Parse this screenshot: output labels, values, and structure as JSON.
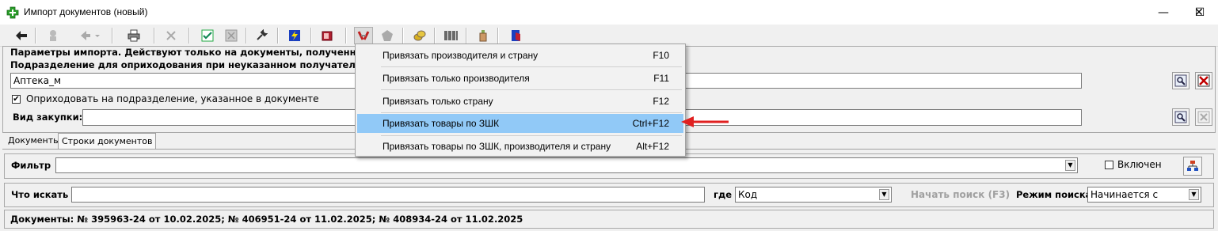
{
  "window": {
    "title": "Импорт документов (новый)",
    "minimize": "—",
    "maximize": "☐",
    "close": "✕"
  },
  "params": {
    "header": "Параметры импорта. Действуют только на документы, полученные НЕ п",
    "dept_label": "Подразделение для оприходования при неуказанном получателе",
    "dept_value": "Аптека_м",
    "checkbox_label": "Оприходовать на подразделение, указанное в документе",
    "checkbox_checked": true,
    "purchase_label": "Вид закупки:",
    "purchase_value": ""
  },
  "tabs": [
    "Документы",
    "Строки документов"
  ],
  "filter": {
    "label": "Фильтр",
    "value": "",
    "enabled_label": "Включен",
    "enabled": false
  },
  "search": {
    "label": "Что искать",
    "value": "",
    "where_label": "где",
    "where_value": "Код",
    "start_button": "Начать поиск (F3)",
    "mode_label": "Режим поиска",
    "mode_value": "Начинается с"
  },
  "status": "Документы: № 395963-24 от 10.02.2025; № 406951-24 от 11.02.2025; № 408934-24 от 11.02.2025",
  "menu": {
    "items": [
      {
        "label": "Привязать производителя и страну",
        "shortcut": "F10"
      },
      {
        "label": "Привязать только производителя",
        "shortcut": "F11"
      },
      {
        "label": "Привязать только страну",
        "shortcut": "F12"
      },
      {
        "label": "Привязать товары по ЗШК",
        "shortcut": "Ctrl+F12"
      },
      {
        "label": "Привязать товары по ЗШК, производителя и страну",
        "shortcut": "Alt+F12"
      }
    ],
    "highlighted_index": 3,
    "highlight_color": "#91c9f7",
    "arrow_color": "#e02020"
  }
}
